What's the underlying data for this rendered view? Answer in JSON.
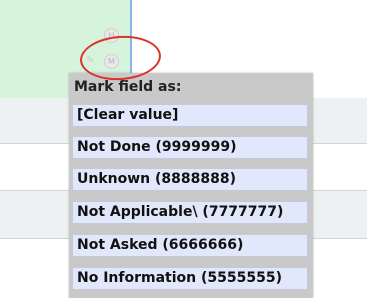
{
  "menu": {
    "title": "Mark field as:",
    "items": [
      "[Clear value]",
      "Not Done (9999999)",
      "Unknown (8888888)",
      "Not Applicable\\ (7777777)",
      "Not Asked (6666666)",
      "No Information (5555555)"
    ]
  },
  "mini_buttons": {
    "h": "H",
    "m": "M"
  },
  "colors": {
    "annotation": "#d9342b",
    "menu_bg": "#c9c9c9",
    "item_bg": "#e1e8fb",
    "cell_green": "#d6f3dc"
  }
}
